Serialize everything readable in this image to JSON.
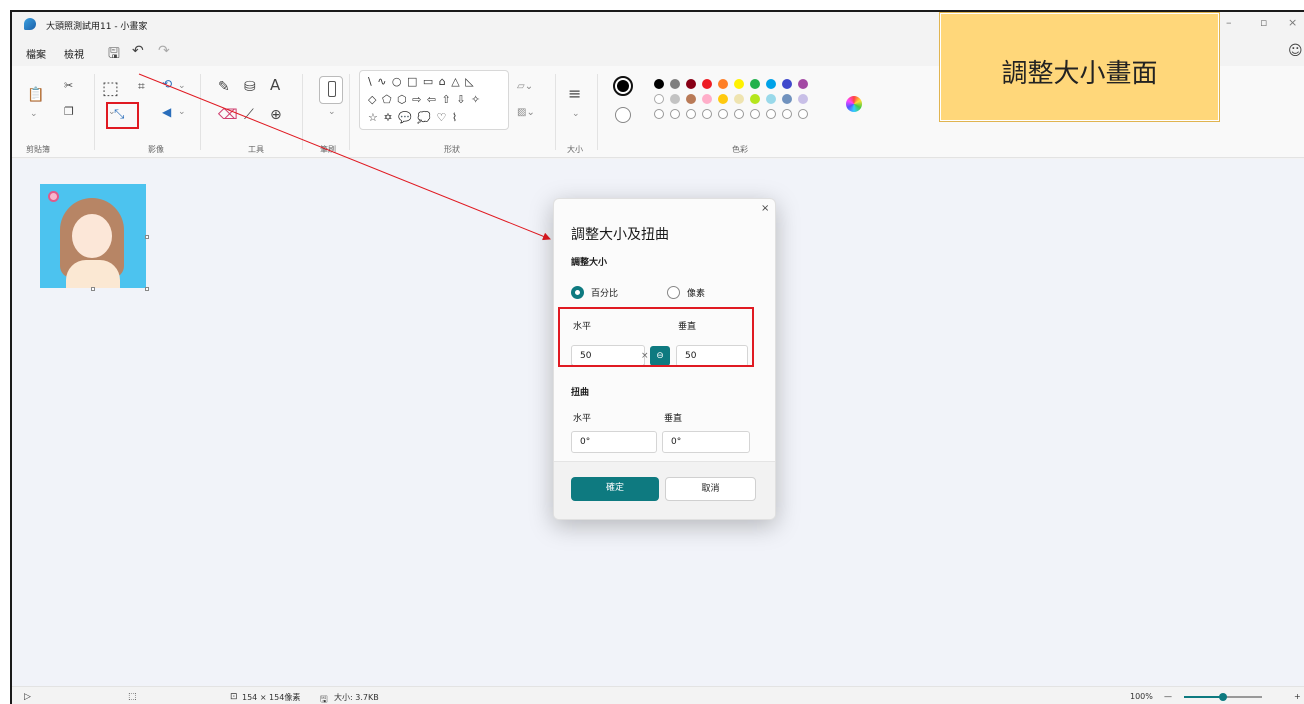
{
  "window": {
    "title": "大頭照測試用11 - 小畫家",
    "controls": {
      "minimize": "–",
      "maximize": "▫",
      "close": "×"
    }
  },
  "menu": {
    "file": "檔案",
    "view": "檢視",
    "save_icon": "save-icon",
    "undo_icon": "undo-icon",
    "redo_icon": "redo-icon",
    "account_icon": "account-icon"
  },
  "ribbon": {
    "groups": {
      "clipboard": "剪貼簿",
      "image": "影像",
      "tools": "工具",
      "brushes": "筆刷",
      "shapes": "形狀",
      "size": "大小",
      "colors": "色彩"
    },
    "text_tool_glyph": "A",
    "shape_rows": [
      "\\ ∿ ○ □ ▭ ⌂ △ ◺",
      "◇ ⬠ ⬡ ⇨ ⇦ ⇧ ⇩ ✧",
      "☆ ✡ 💬 💭 ♡ ⌇"
    ],
    "palette": {
      "row1": [
        "#000000",
        "#7f7f7f",
        "#880015",
        "#ed1c24",
        "#ff7f27",
        "#fff200",
        "#22b14c",
        "#00a2e8",
        "#3f48cc",
        "#a349a4"
      ],
      "row2": [
        "#ffffff",
        "#c3c3c3",
        "#b97a57",
        "#ffaec9",
        "#ffc90e",
        "#efe4b0",
        "#b5e61d",
        "#99d9ea",
        "#7092be",
        "#c8bfe7"
      ]
    },
    "color1": "#000000",
    "color2": "#ffffff",
    "accent": "#0e7a80",
    "highlight": "#e01a22"
  },
  "callout": {
    "text": "調整大小畫面"
  },
  "dialog": {
    "title": "調整大小及扭曲",
    "close": "×",
    "resize_section": "調整大小",
    "option_percent": "百分比",
    "option_pixels": "像素",
    "resize_h_label": "水平",
    "resize_v_label": "垂直",
    "resize_h_value": "50",
    "resize_v_value": "50",
    "clear": "×",
    "link_icon": "⊖",
    "skew_section": "扭曲",
    "skew_h_label": "水平",
    "skew_v_label": "垂直",
    "skew_h_value": "0°",
    "skew_v_value": "0°",
    "ok": "確定",
    "cancel": "取消"
  },
  "status": {
    "pointer_icon": "pointer-icon",
    "selection_icon": "selection-icon",
    "dimensions": "154 × 154像素",
    "file_size": "大小: 3.7KB",
    "zoom": "100%",
    "zoom_minus": "—",
    "zoom_plus": "+",
    "zoom_level": 0.5
  }
}
